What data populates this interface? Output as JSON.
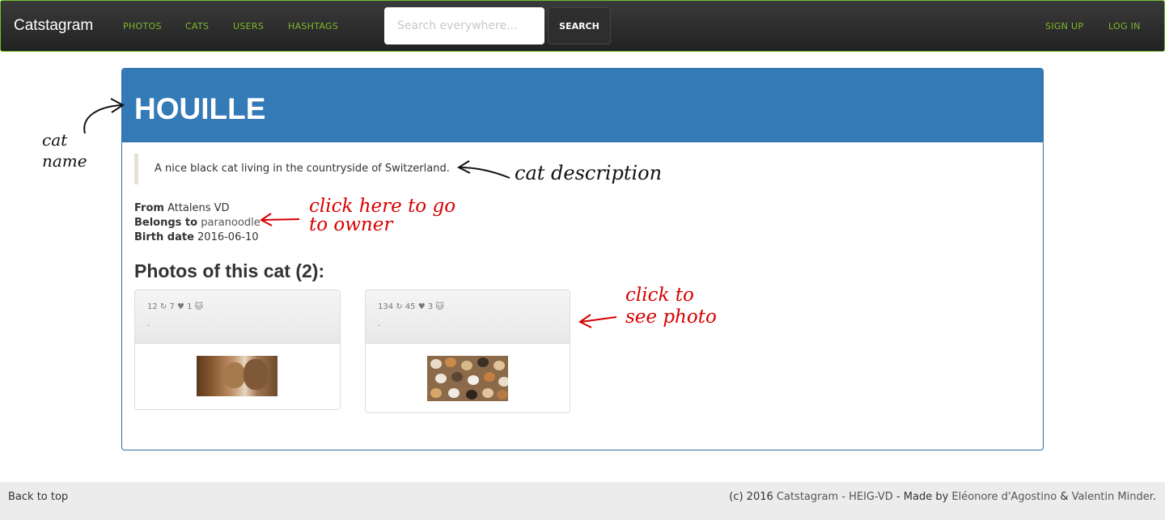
{
  "navbar": {
    "brand": "Catstagram",
    "links": [
      "PHOTOS",
      "CATS",
      "USERS",
      "HASHTAGS"
    ],
    "search_placeholder": "Search everywhere...",
    "search_button": "SEARCH",
    "signup": "SIGN UP",
    "login": "LOG IN"
  },
  "cat": {
    "name": "HOUILLE",
    "description": "A nice black cat living in the countryside of Switzerland.",
    "from_label": "From",
    "from_value": "Attalens VD",
    "owner_label": "Belongs to",
    "owner_value": "paranoodle",
    "birth_label": "Birth date",
    "birth_value": "2016-06-10"
  },
  "photos": {
    "title": "Photos of this cat (2):",
    "items": [
      {
        "stats": "12 ↻ 7 ♥ 1 🐱",
        "caption": "."
      },
      {
        "stats": "134 ↻ 45 ♥ 3 🐱",
        "caption": "."
      }
    ]
  },
  "annotations": {
    "cat_name": "cat name",
    "cat_description": "cat description",
    "owner": "click here to go to owner",
    "photo": "click to see photo"
  },
  "footer": {
    "back_to_top": "Back to top",
    "copyright_prefix": "(c) 2016",
    "site_name": "Catstagram - HEIG-VD",
    "made_by_prefix": "- Made by",
    "author1": "Eléonore d'Agostino",
    "and": "&",
    "author2": "Valentin Minder",
    "period": "."
  },
  "colors": {
    "nav_link": "#7fb82d",
    "panel_heading": "#337ab7",
    "annotation_red": "#d80000"
  }
}
